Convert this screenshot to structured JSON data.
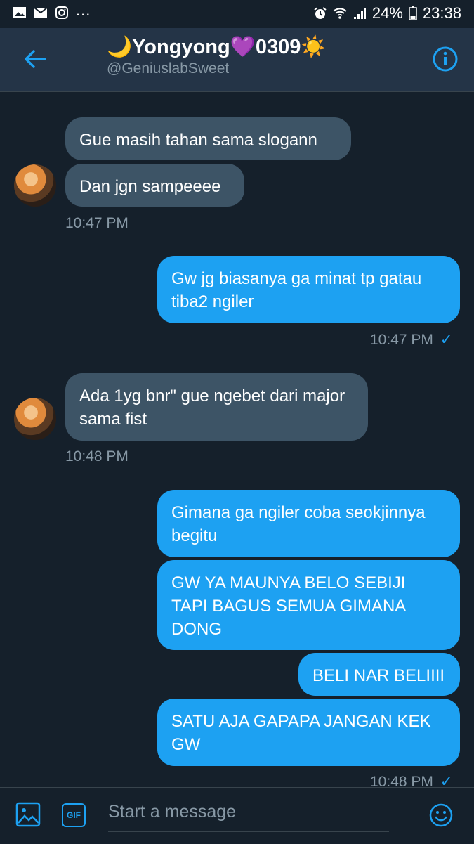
{
  "status": {
    "battery": "24%",
    "time": "23:38",
    "more": "..."
  },
  "header": {
    "title": "🌙Yongyong💜0309☀️",
    "handle": "@GeniuslabSweet"
  },
  "messages": {
    "m1": "Gue masih tahan sama slogann",
    "m2": "Dan jgn sampeeee",
    "t1": "10:47 PM",
    "m3": "Gw jg biasanya ga minat tp gatau tiba2 ngiler",
    "t2": "10:47 PM",
    "m4": "Ada 1yg bnr\" gue ngebet dari major sama fist",
    "t3": "10:48 PM",
    "m5": "Gimana ga ngiler coba seokjinnya begitu",
    "m6": "GW YA MAUNYA BELO SEBIJI TAPI BAGUS SEMUA GIMANA DONG",
    "m7": "BELI NAR BELIIII",
    "m8": "SATU AJA GAPAPA JANGAN KEK GW",
    "t4": "10:48 PM"
  },
  "composer": {
    "placeholder": "Start a message",
    "gif_label": "GIF"
  },
  "colors": {
    "accent": "#1da1f2",
    "incoming_bubble": "#3d5466",
    "background": "#15202b",
    "header": "#243447"
  }
}
